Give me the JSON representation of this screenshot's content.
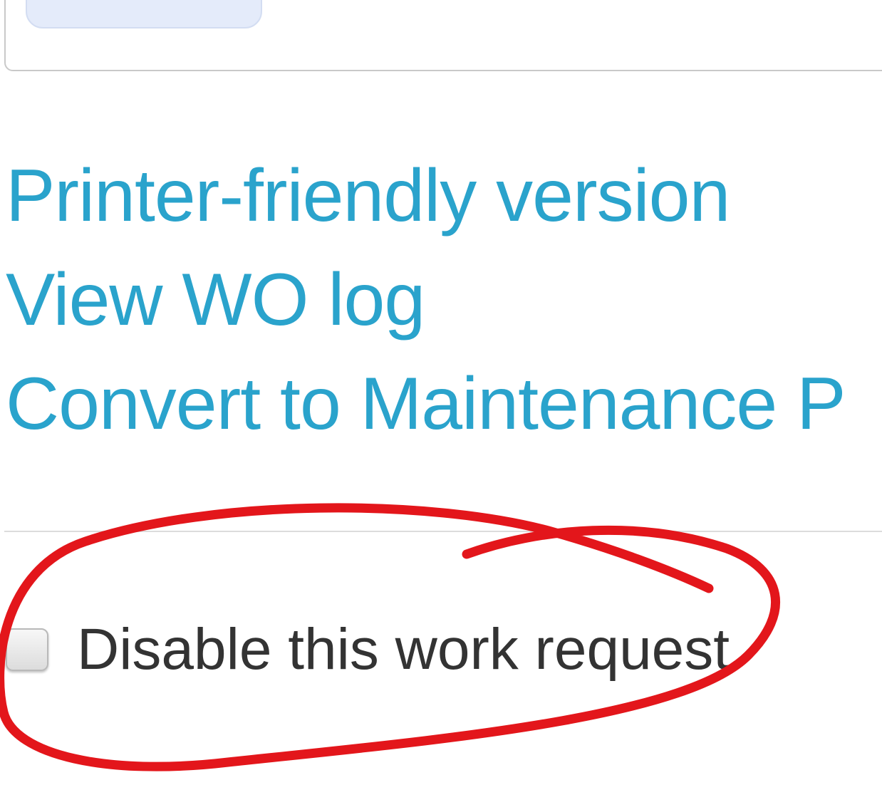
{
  "links": {
    "printer_friendly": "Printer-friendly version",
    "view_wo_log": "View WO log",
    "convert_to_pm": "Convert to Maintenance P"
  },
  "disable": {
    "label": "Disable this work request",
    "checked": false
  },
  "annotation": {
    "color": "#e3161b"
  }
}
